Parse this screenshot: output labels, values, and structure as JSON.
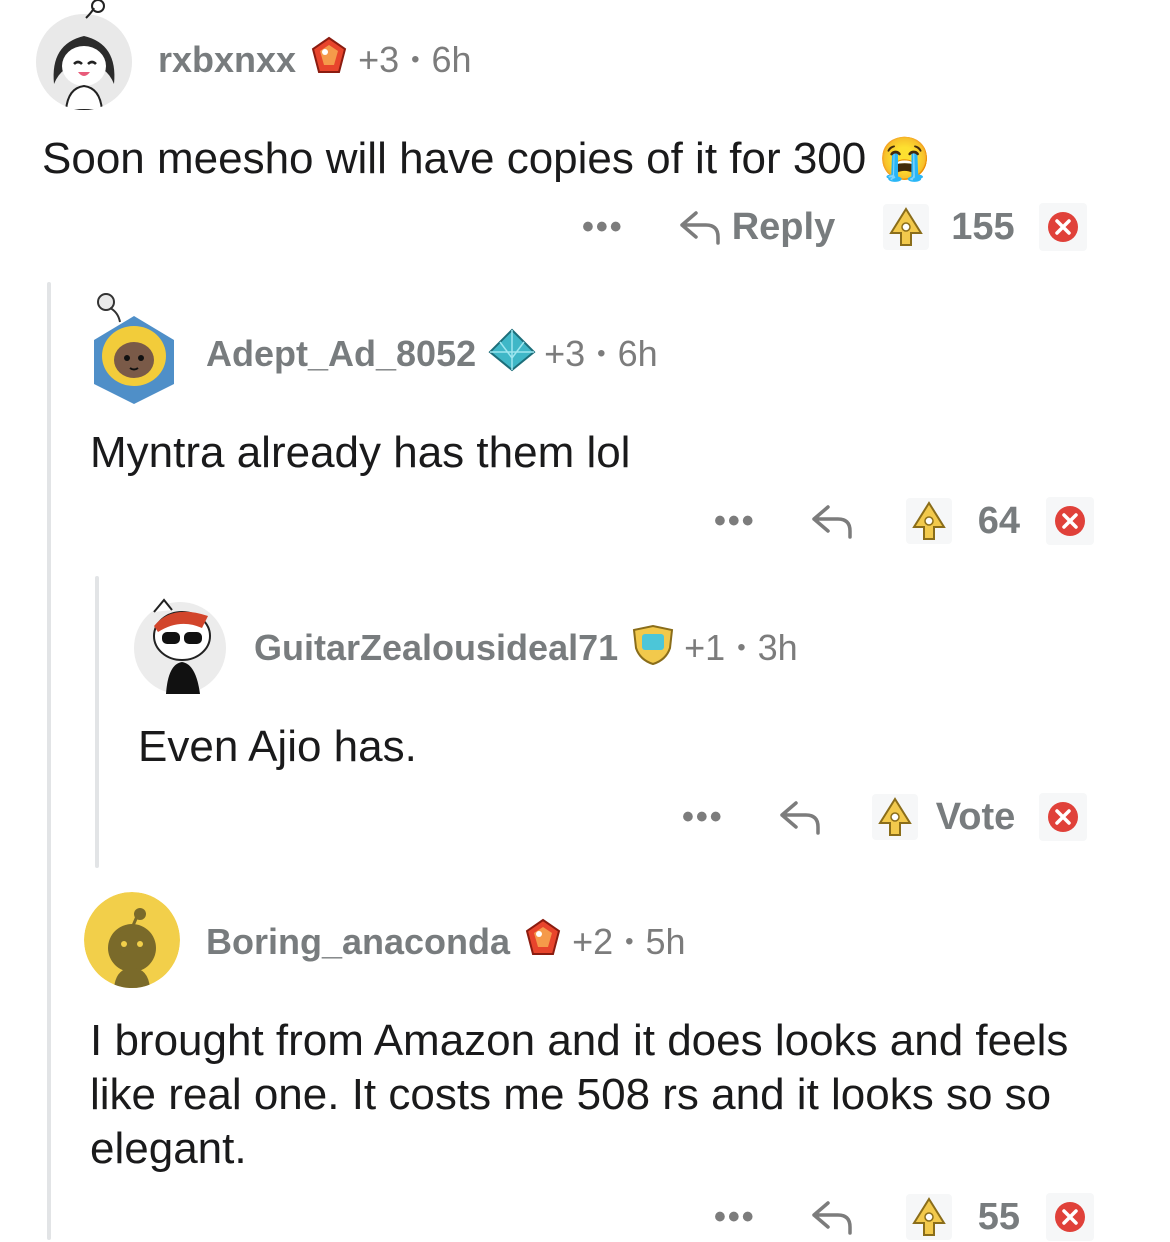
{
  "comments": [
    {
      "username": "rxbxnxx",
      "karma": "+3",
      "sep": "•",
      "age": "6h",
      "body": "Soon meesho will have copies of it for 300",
      "emoji": "😭",
      "more": "•••",
      "reply_label": "Reply",
      "score": "155"
    },
    {
      "username": "Adept_Ad_8052",
      "karma": "+3",
      "sep": "•",
      "age": "6h",
      "body": "Myntra already has them lol",
      "more": "•••",
      "score": "64"
    },
    {
      "username": "GuitarZealousideal71",
      "karma": "+1",
      "sep": "•",
      "age": "3h",
      "body": "Even Ajio has.",
      "more": "•••",
      "score": "Vote"
    },
    {
      "username": "Boring_anaconda",
      "karma": "+2",
      "sep": "•",
      "age": "5h",
      "body": "I brought from Amazon and it does looks and feels like real one. It costs me 508 rs and it looks so so elegant.",
      "more": "•••",
      "score": "55"
    }
  ],
  "colors": {
    "thread_line": "#e2e4e6",
    "meta_gray": "#787c7e",
    "downvote_red": "#e0413a",
    "snoo_yellow": "#f2cf4a"
  }
}
